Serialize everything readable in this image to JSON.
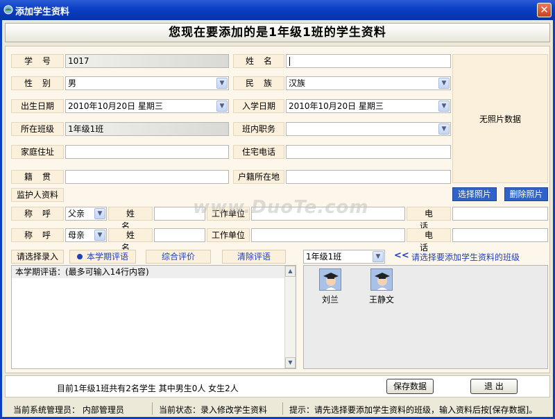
{
  "window": {
    "title": "添加学生资料",
    "close_label": "✕"
  },
  "header": "您现在要添加的是1年级1班的学生资料",
  "form": {
    "student_no_label": "学号",
    "student_no": "1017",
    "name_label": "姓名",
    "name": "",
    "gender_label": "性别",
    "gender": "男",
    "ethnicity_label": "民族",
    "ethnicity": "汉族",
    "birth_label": "出生日期",
    "birth": "2010年10月20日  星期三",
    "enroll_label": "入学日期",
    "enroll": "2010年10月20日  星期三",
    "class_label": "所在班级",
    "class": "1年级1班",
    "position_label": "班内职务",
    "position": "",
    "address_label": "家庭住址",
    "address": "",
    "phone_label": "住宅电话",
    "phone": "",
    "origin_label": "籍贯",
    "origin": "",
    "hukou_label": "户籍所在地",
    "hukou": ""
  },
  "photo": {
    "no_photo": "无照片数据",
    "select_label": "选择照片",
    "delete_label": "删除照片"
  },
  "guardian": {
    "section_label": "监护人资料",
    "rows": [
      {
        "title_label": "称呼",
        "title": "父亲",
        "name_label": "姓名",
        "name": "",
        "work_label": "工作单位",
        "work": "",
        "phone_label": "电话",
        "phone": ""
      },
      {
        "title_label": "称呼",
        "title": "母亲",
        "name_label": "姓名",
        "name": "",
        "work_label": "工作单位",
        "work": "",
        "phone_label": "电话",
        "phone": ""
      }
    ]
  },
  "tabs": {
    "select_entry": "请选择录入",
    "semester_comment": "本学期评语",
    "overall": "综合评价",
    "clear_comment": "清除评语"
  },
  "comment_hint": "本学期评语：(最多可输入14行内容)",
  "class_select": {
    "value": "1年级1班",
    "hint": "请选择要添加学生资料的班级",
    "arrow": "<<"
  },
  "students": [
    {
      "name": "刘兰"
    },
    {
      "name": "王静文"
    }
  ],
  "summary": "目前1年级1班共有2名学生   其中男生0人   女生2人",
  "buttons": {
    "save": "保存数据",
    "exit": "退 出"
  },
  "status": {
    "admin": "当前系统管理员：  内部管理员",
    "state": "当前状态：录入修改学生资料",
    "hint": "提示：请先选择要添加学生资料的班级，输入资料后按[保存数据]。"
  },
  "watermark": "www.DuoTe.com",
  "colors": {
    "titlebar": "#0a3fc4",
    "label_bg": "#fbf0dc",
    "accent_blue": "#2f63c7",
    "link_blue": "#1f3fbf"
  }
}
